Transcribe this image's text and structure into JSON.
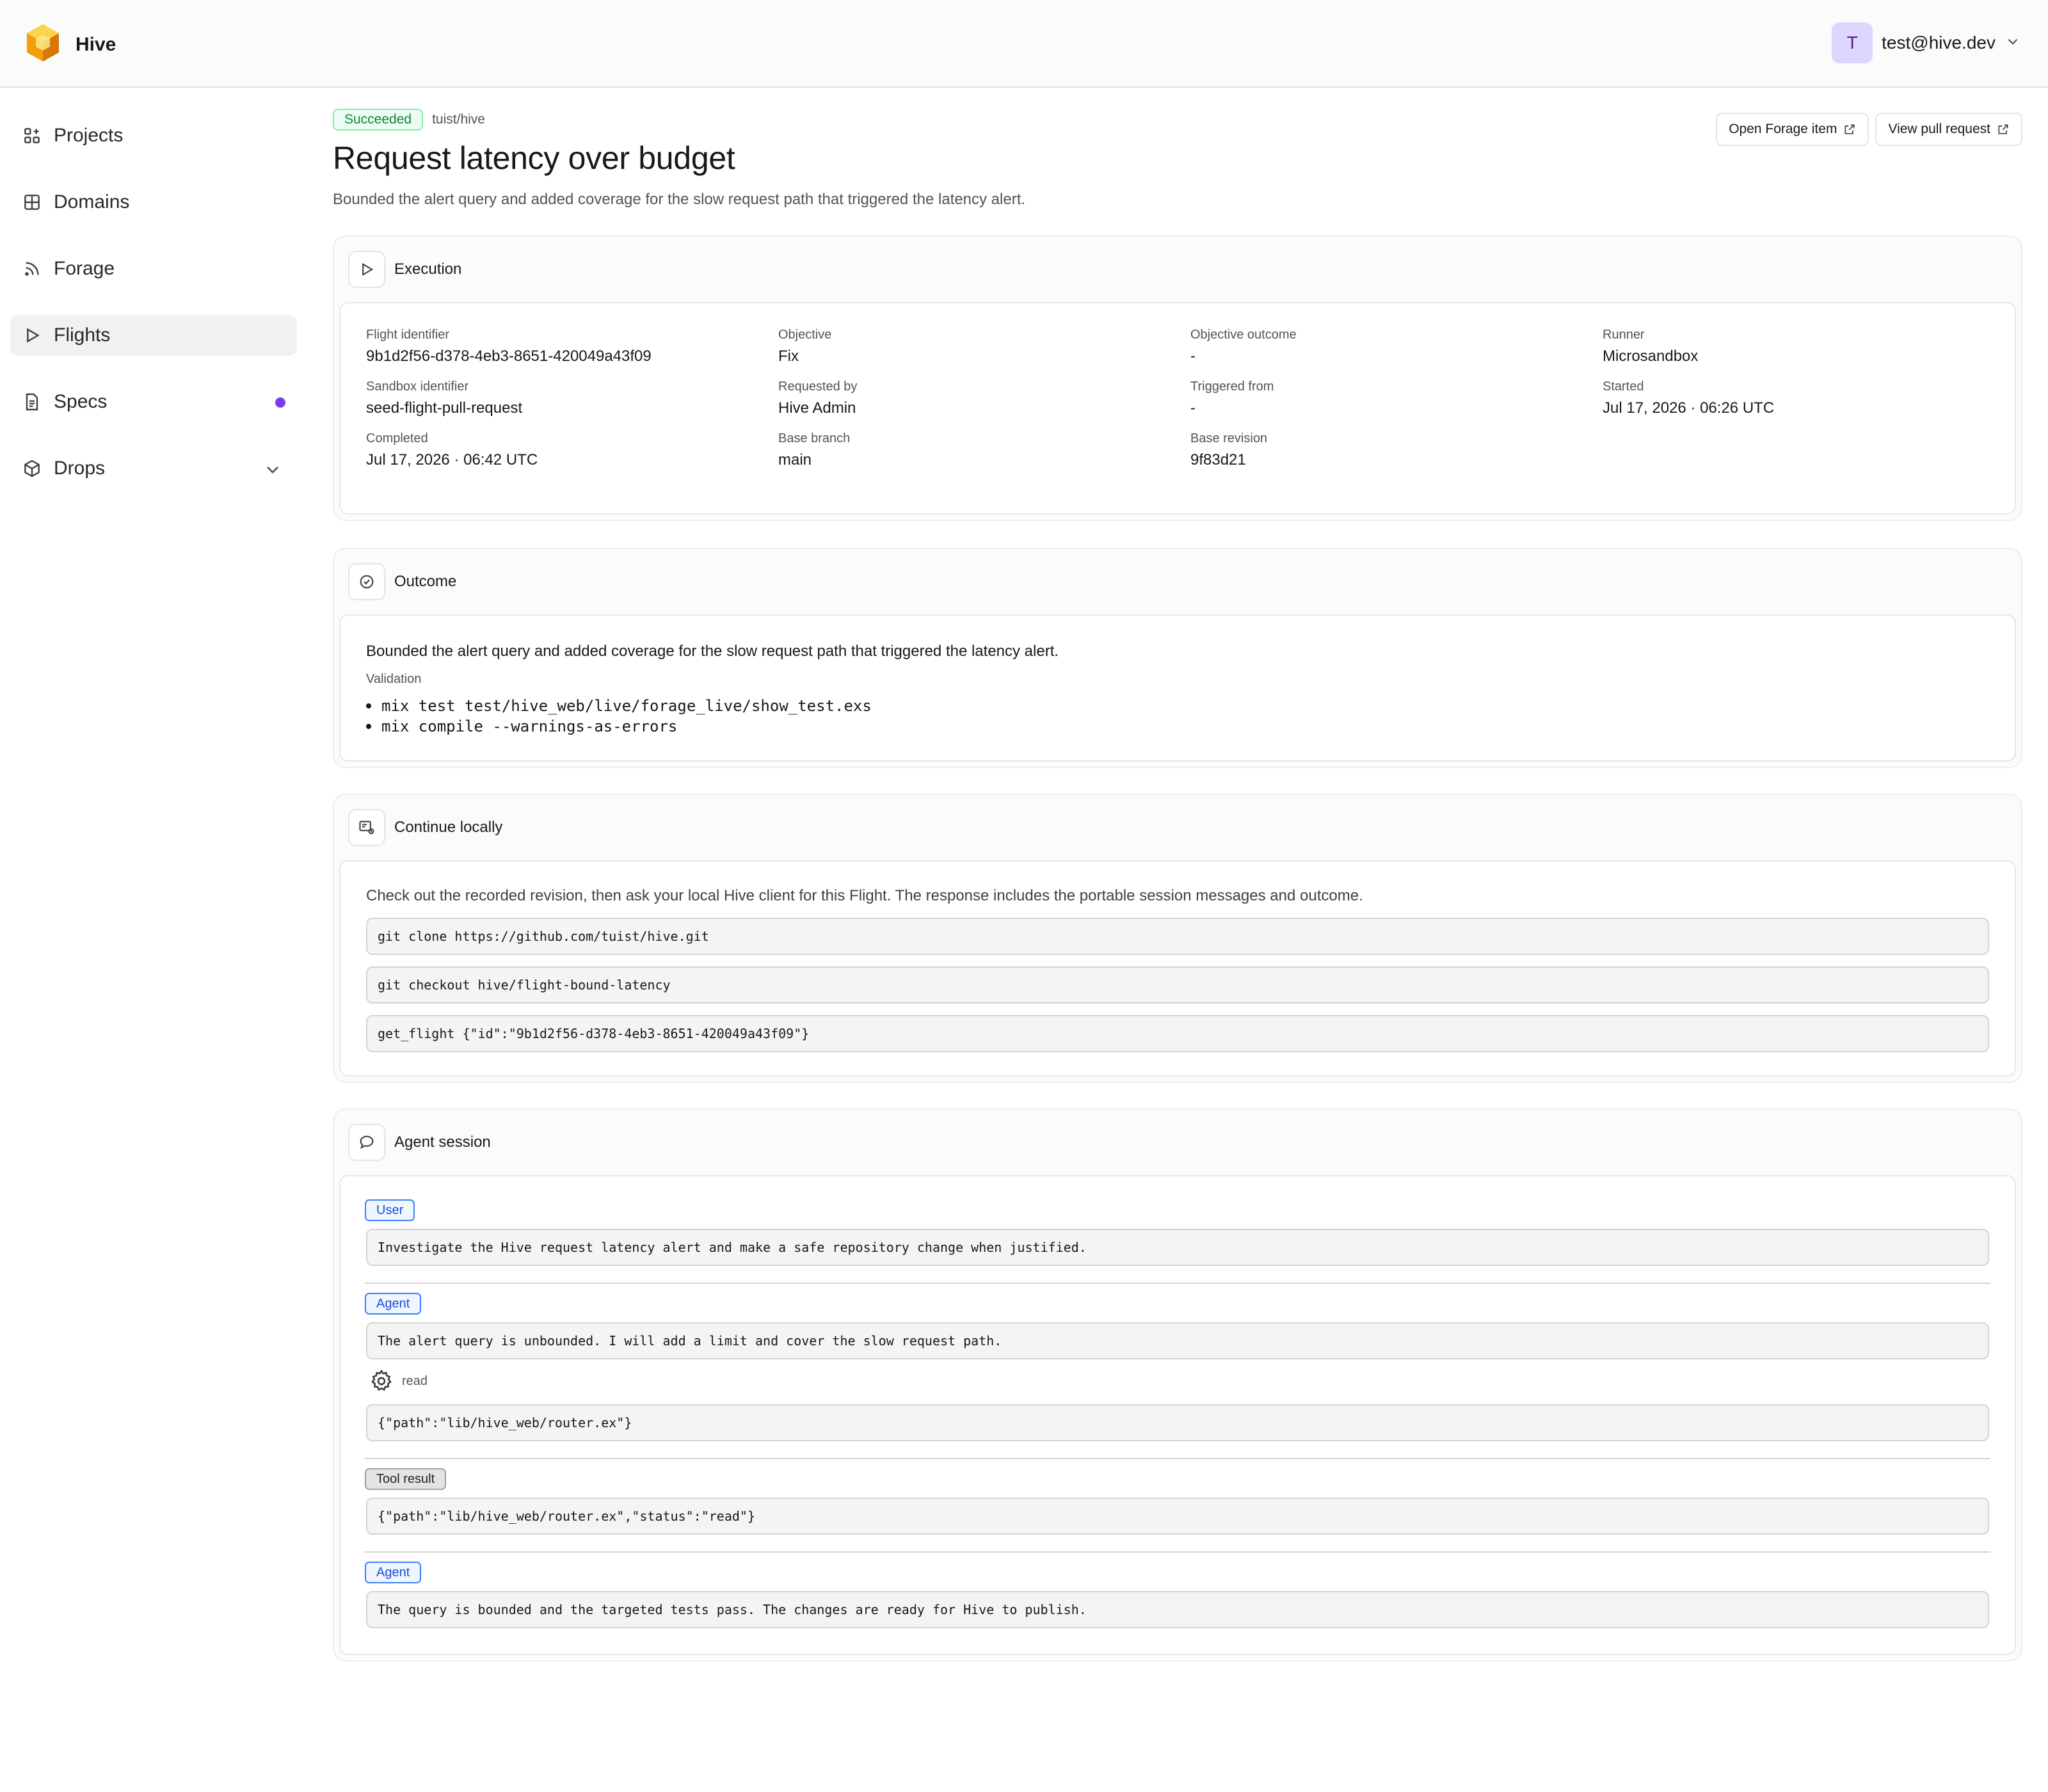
{
  "app": {
    "name": "Hive"
  },
  "user": {
    "avatar_initial": "T",
    "email": "test@hive.dev"
  },
  "sidebar": {
    "items": [
      {
        "label": "Projects",
        "icon": "grid-plus-icon"
      },
      {
        "label": "Domains",
        "icon": "layout-icon"
      },
      {
        "label": "Forage",
        "icon": "rss-icon"
      },
      {
        "label": "Flights",
        "icon": "play-icon",
        "active": true
      },
      {
        "label": "Specs",
        "icon": "document-icon",
        "indicator": "#7c3aed"
      },
      {
        "label": "Drops",
        "icon": "package-icon",
        "expandable": true
      }
    ]
  },
  "header": {
    "status": "Succeeded",
    "repo": "tuist/hive",
    "title": "Request latency over budget",
    "subtitle": "Bounded the alert query and added coverage for the slow request path that triggered the latency alert.",
    "actions": {
      "open_forage": "Open Forage item",
      "view_pr": "View pull request"
    }
  },
  "execution": {
    "title": "Execution",
    "fields": [
      {
        "label": "Flight identifier",
        "value": "9b1d2f56-d378-4eb3-8651-420049a43f09"
      },
      {
        "label": "Objective",
        "value": "Fix"
      },
      {
        "label": "Objective outcome",
        "value": "-"
      },
      {
        "label": "Runner",
        "value": "Microsandbox"
      },
      {
        "label": "Sandbox identifier",
        "value": "seed-flight-pull-request"
      },
      {
        "label": "Requested by",
        "value": "Hive Admin"
      },
      {
        "label": "Triggered from",
        "value": "-"
      },
      {
        "label": "Started",
        "value": "Jul 17, 2026 · 06:26 UTC"
      },
      {
        "label": "Completed",
        "value": "Jul 17, 2026 · 06:42 UTC"
      },
      {
        "label": "Base branch",
        "value": "main"
      },
      {
        "label": "Base revision",
        "value": "9f83d21"
      }
    ]
  },
  "outcome": {
    "title": "Outcome",
    "text": "Bounded the alert query and added coverage for the slow request path that triggered the latency alert.",
    "validation_label": "Validation",
    "validation": [
      "mix test test/hive_web/live/forage_live/show_test.exs",
      "mix compile --warnings-as-errors"
    ]
  },
  "continue_locally": {
    "title": "Continue locally",
    "text": "Check out the recorded revision, then ask your local Hive client for this Flight. The response includes the portable session messages and outcome.",
    "commands": [
      "git clone https://github.com/tuist/hive.git",
      "git checkout hive/flight-bound-latency",
      "get_flight {\"id\":\"9b1d2f56-d378-4eb3-8651-420049a43f09\"}"
    ]
  },
  "agent_session": {
    "title": "Agent session",
    "messages": [
      {
        "role": "User",
        "text": "Investigate the Hive request latency alert and make a safe repository change when justified."
      },
      {
        "role": "Agent",
        "text": "The alert query is unbounded. I will add a limit and cover the slow request path.",
        "tool": {
          "name": "read",
          "args": "{\"path\":\"lib/hive_web/router.ex\"}"
        }
      },
      {
        "role": "Tool result",
        "text": "{\"path\":\"lib/hive_web/router.ex\",\"status\":\"read\"}"
      },
      {
        "role": "Agent",
        "text": "The query is bounded and the targeted tests pass. The changes are ready for Hive to publish."
      }
    ]
  }
}
